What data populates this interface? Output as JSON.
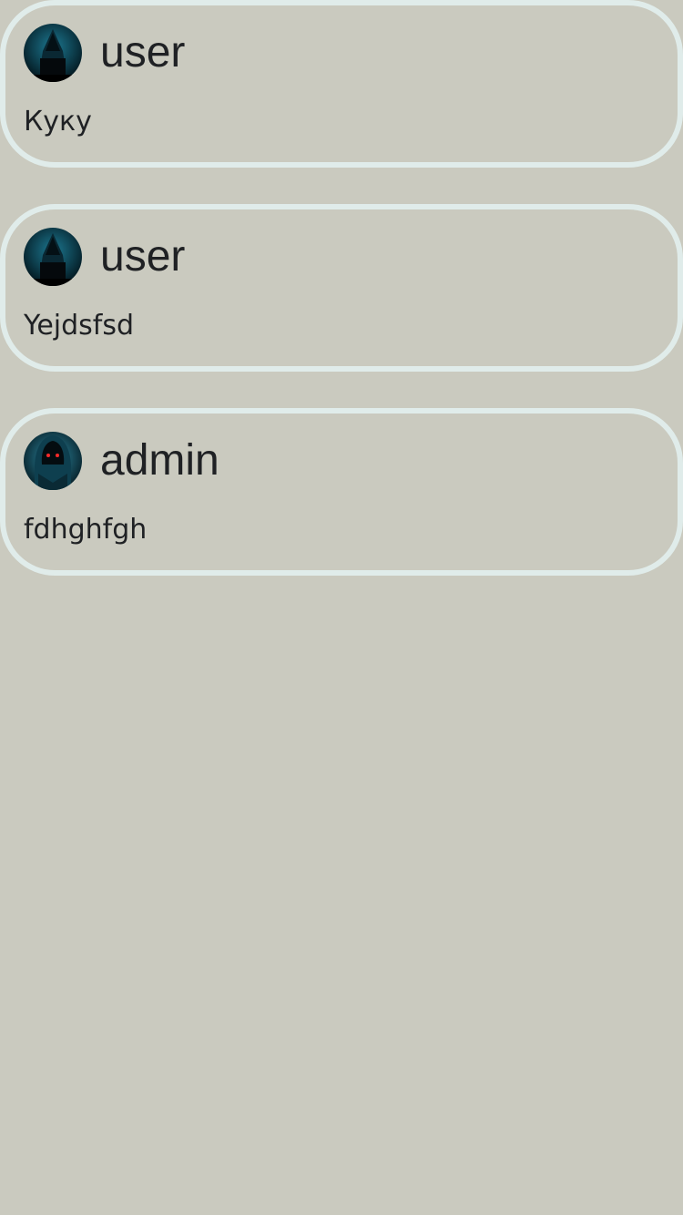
{
  "posts": [
    {
      "author": "user",
      "message": "Куку",
      "avatar_icon": "hooded-hacker-laptop-avatar-icon"
    },
    {
      "author": "user",
      "message": "Yejdsfsd",
      "avatar_icon": "hooded-hacker-laptop-avatar-icon"
    },
    {
      "author": "admin",
      "message": "fdhghfgh",
      "avatar_icon": "hooded-figure-red-eyes-avatar-icon"
    }
  ],
  "colors": {
    "background": "#cacabf",
    "card_border": "#e0ecea",
    "text": "#1f2124"
  }
}
